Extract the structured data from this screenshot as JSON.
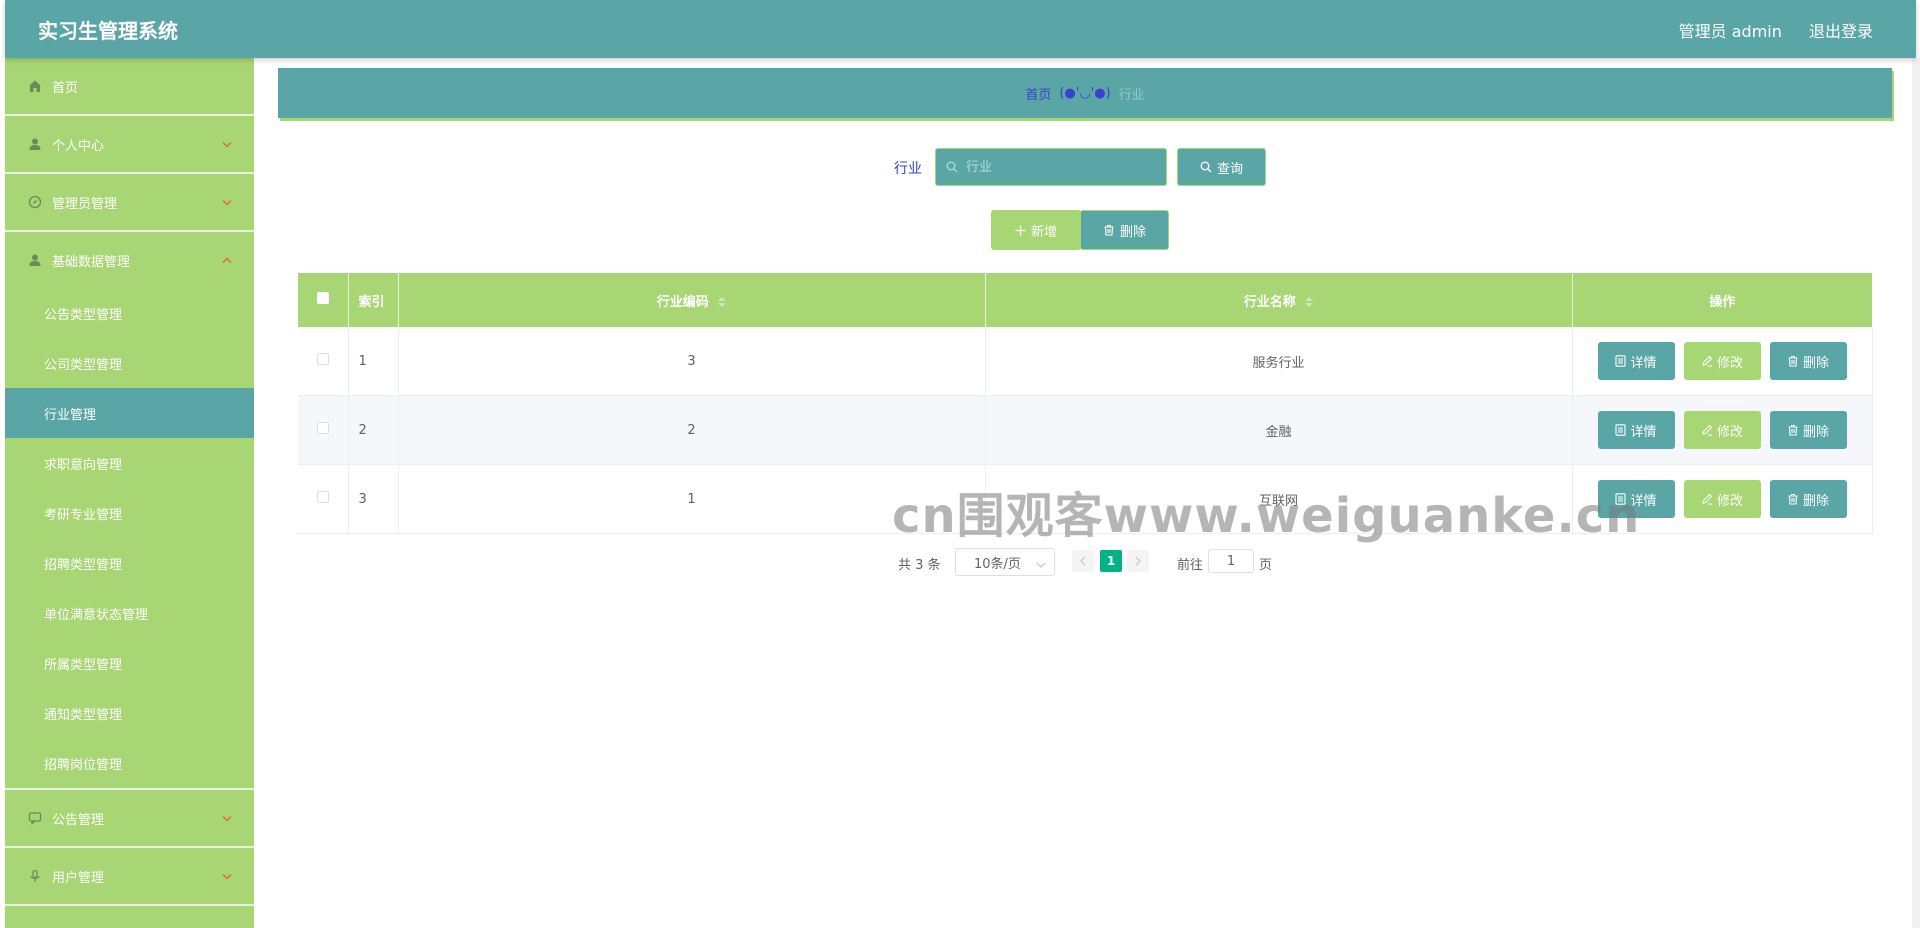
{
  "header": {
    "title": "实习生管理系统",
    "user_label": "管理员 admin",
    "logout_label": "退出登录"
  },
  "sidebar": {
    "home": "首页",
    "groups": [
      {
        "label": "个人中心"
      },
      {
        "label": "管理员管理"
      },
      {
        "label": "基础数据管理"
      }
    ],
    "sub_items": [
      {
        "label": "公告类型管理"
      },
      {
        "label": "公司类型管理"
      },
      {
        "label": "行业管理"
      },
      {
        "label": "求职意向管理"
      },
      {
        "label": "考研专业管理"
      },
      {
        "label": "招聘类型管理"
      },
      {
        "label": "单位满意状态管理"
      },
      {
        "label": "所属类型管理"
      },
      {
        "label": "通知类型管理"
      },
      {
        "label": "招聘岗位管理"
      }
    ],
    "after_groups": [
      {
        "label": "公告管理"
      },
      {
        "label": "用户管理"
      }
    ]
  },
  "breadcrumb": {
    "home": "首页",
    "separator": "(●'◡'●)",
    "current": "行业"
  },
  "search": {
    "label": "行业",
    "placeholder": "行业",
    "button": "查询"
  },
  "actions": {
    "add": "新增",
    "delete": "删除"
  },
  "table": {
    "columns": {
      "index": "索引",
      "code": "行业编码",
      "name": "行业名称",
      "ops": "操作"
    },
    "rows": [
      {
        "index": "1",
        "code": "3",
        "name": "服务行业"
      },
      {
        "index": "2",
        "code": "2",
        "name": "金融"
      },
      {
        "index": "3",
        "code": "1",
        "name": "互联网"
      }
    ],
    "op_labels": {
      "detail": "详情",
      "edit": "修改",
      "delete": "删除"
    }
  },
  "pagination": {
    "total": "共 3 条",
    "page_size": "10条/页",
    "current_page": "1",
    "goto_label": "前往",
    "goto_value": "1",
    "goto_suffix": "页"
  },
  "watermark": "cn围观客www.weiguanke.cn",
  "colors": {
    "teal": "#5aa6a7",
    "green": "#a8d675",
    "active_page": "#00b386"
  }
}
